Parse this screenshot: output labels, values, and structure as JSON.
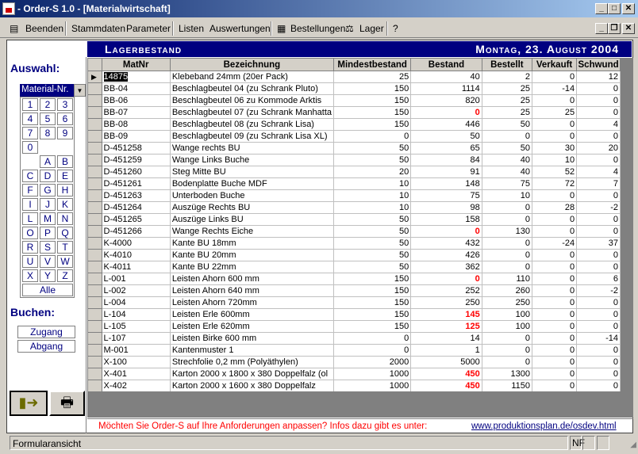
{
  "window": {
    "title": "- Order-S 1.0 - [Materialwirtschaft]"
  },
  "menu": {
    "items": [
      "Beenden",
      "Stammdaten",
      "Parameter",
      "Listen",
      "Auswertungen",
      "Bestellungen",
      "Lager",
      "?"
    ]
  },
  "header": {
    "title": "Lagerbestand",
    "date": "Montag, 23. August 2004"
  },
  "sidebar": {
    "auswahl_label": "Auswahl:",
    "dropdown_value": "Material-Nr.",
    "keys": [
      [
        "1",
        "2",
        "3"
      ],
      [
        "4",
        "5",
        "6"
      ],
      [
        "7",
        "8",
        "9"
      ],
      [
        "0"
      ],
      [
        "",
        "A",
        "B"
      ],
      [
        "C",
        "D",
        "E"
      ],
      [
        "F",
        "G",
        "H"
      ],
      [
        "I",
        "J",
        "K"
      ],
      [
        "L",
        "M",
        "N"
      ],
      [
        "O",
        "P",
        "Q"
      ],
      [
        "R",
        "S",
        "T"
      ],
      [
        "U",
        "V",
        "W"
      ],
      [
        "X",
        "Y",
        "Z"
      ]
    ],
    "all_label": "Alle",
    "buchen_label": "Buchen:",
    "zugang_label": "Zugang",
    "abgang_label": "Abgang",
    "exit_icon": "door-exit-icon",
    "print_icon": "printer-icon"
  },
  "table": {
    "columns": [
      "MatNr",
      "Bezeichnung",
      "Mindestbestand",
      "Bestand",
      "Bestellt",
      "Verkauft",
      "Schwund"
    ],
    "rows": [
      [
        "14875",
        "Klebeband 24mm (20er Pack)",
        25,
        40,
        2,
        0,
        12
      ],
      [
        "BB-04",
        "Beschlagbeutel 04 (zu Schrank Pluto)",
        150,
        1114,
        25,
        -14,
        0
      ],
      [
        "BB-06",
        "Beschlagbeutel 06 zu Kommode Arktis",
        150,
        820,
        25,
        0,
        0
      ],
      [
        "BB-07",
        "Beschlagbeutel 07 (zu Schrank Manhatta",
        150,
        0,
        25,
        25,
        0
      ],
      [
        "BB-08",
        "Beschlagbeutel 08 (zu Schrank Lisa)",
        150,
        446,
        50,
        0,
        4
      ],
      [
        "BB-09",
        "Beschlagbeutel 09 (zu Schrank Lisa XL)",
        0,
        50,
        0,
        0,
        0
      ],
      [
        "D-451258",
        "Wange rechts BU",
        50,
        65,
        50,
        30,
        20
      ],
      [
        "D-451259",
        "Wange Links Buche",
        50,
        84,
        40,
        10,
        0
      ],
      [
        "D-451260",
        "Steg Mitte BU",
        20,
        91,
        40,
        52,
        4
      ],
      [
        "D-451261",
        "Bodenplatte Buche MDF",
        10,
        148,
        75,
        72,
        7
      ],
      [
        "D-451263",
        "Unterboden Buche",
        10,
        75,
        10,
        0,
        0
      ],
      [
        "D-451264",
        "Auszüge Rechts BU",
        10,
        98,
        0,
        28,
        -2
      ],
      [
        "D-451265",
        "Auszüge Links BU",
        50,
        158,
        0,
        0,
        0
      ],
      [
        "D-451266",
        "Wange Rechts Eiche",
        50,
        0,
        130,
        0,
        0
      ],
      [
        "K-4000",
        "Kante BU 18mm",
        50,
        432,
        0,
        -24,
        37
      ],
      [
        "K-4010",
        "Kante BU 20mm",
        50,
        426,
        0,
        0,
        0
      ],
      [
        "K-4011",
        "Kante BU 22mm",
        50,
        362,
        0,
        0,
        0
      ],
      [
        "L-001",
        "Leisten Ahorn 600 mm",
        150,
        0,
        110,
        0,
        6
      ],
      [
        "L-002",
        "Leisten Ahorn 640 mm",
        150,
        252,
        260,
        0,
        -2
      ],
      [
        "L-004",
        "Leisten Ahorn 720mm",
        150,
        250,
        250,
        0,
        0
      ],
      [
        "L-104",
        "Leisten Erle 600mm",
        150,
        145,
        100,
        0,
        0
      ],
      [
        "L-105",
        "Leisten Erle 620mm",
        150,
        125,
        100,
        0,
        0
      ],
      [
        "L-107",
        "Leisten Birke 600 mm",
        0,
        14,
        0,
        0,
        -14
      ],
      [
        "M-001",
        "Kantenmuster 1",
        0,
        1,
        0,
        0,
        0
      ],
      [
        "X-100",
        "Strechfolie 0,2 mm (Polyäthylen)",
        2000,
        5000,
        0,
        0,
        0
      ],
      [
        "X-401",
        "Karton 2000 x 1800 x 380 Doppelfalz (ol",
        1000,
        450,
        1300,
        0,
        0
      ],
      [
        "X-402",
        "Karton 2000 x 1600 x 380 Doppelfalz",
        1000,
        450,
        1150,
        0,
        0
      ]
    ]
  },
  "footer": {
    "message": "Möchten Sie Order-S auf Ihre Anforderungen anpassen? Infos dazu gibt es unter:",
    "link": "www.produktionsplan.de/osdev.html"
  },
  "statusbar": {
    "text": "Formularansicht",
    "indicator": "NF"
  },
  "colors": {
    "title_band": "#000080",
    "below_min": "#ff0000",
    "link": "#000080"
  }
}
